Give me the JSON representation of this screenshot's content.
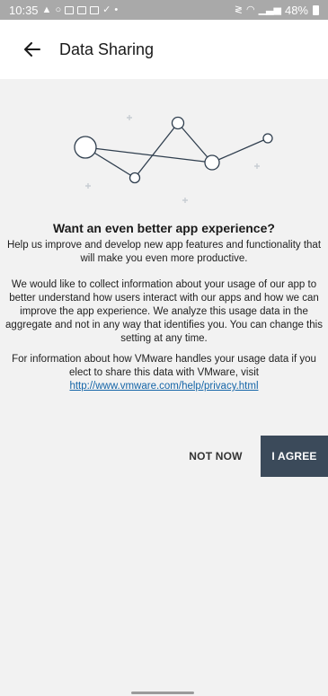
{
  "status_bar": {
    "time": "10:35",
    "battery": "48%",
    "icons_left": [
      "alert-icon",
      "circle-icon",
      "message-icon",
      "calendar-icon",
      "gallery-icon",
      "check-icon",
      "dot-icon"
    ],
    "icons_right": [
      "nfc-icon",
      "wifi-icon",
      "signal-icon",
      "battery-icon"
    ]
  },
  "app_bar": {
    "back_icon": "arrow-left-icon",
    "title": "Data Sharing"
  },
  "content": {
    "headline": "Want an even better app experience?",
    "paragraph1": "Help us improve and develop new app features and functionality that will make you even more productive.",
    "paragraph2": "We would like to collect information about your usage of our app to better understand how users interact with our apps and how we can improve the app experience. We analyze this usage data in the aggregate and not in any way that identifies you. You can change this setting at any time.",
    "paragraph3": "For information about how VMware handles your usage data if you elect to share this data with VMware, visit",
    "privacy_link": "http://www.vmware.com/help/privacy.html"
  },
  "buttons": {
    "not_now": "NOT NOW",
    "agree": "I AGREE"
  },
  "colors": {
    "status_bar": "#a9a9a9",
    "agree_button": "#3b4a5a",
    "link": "#1565a8",
    "background": "#f2f2f2"
  }
}
